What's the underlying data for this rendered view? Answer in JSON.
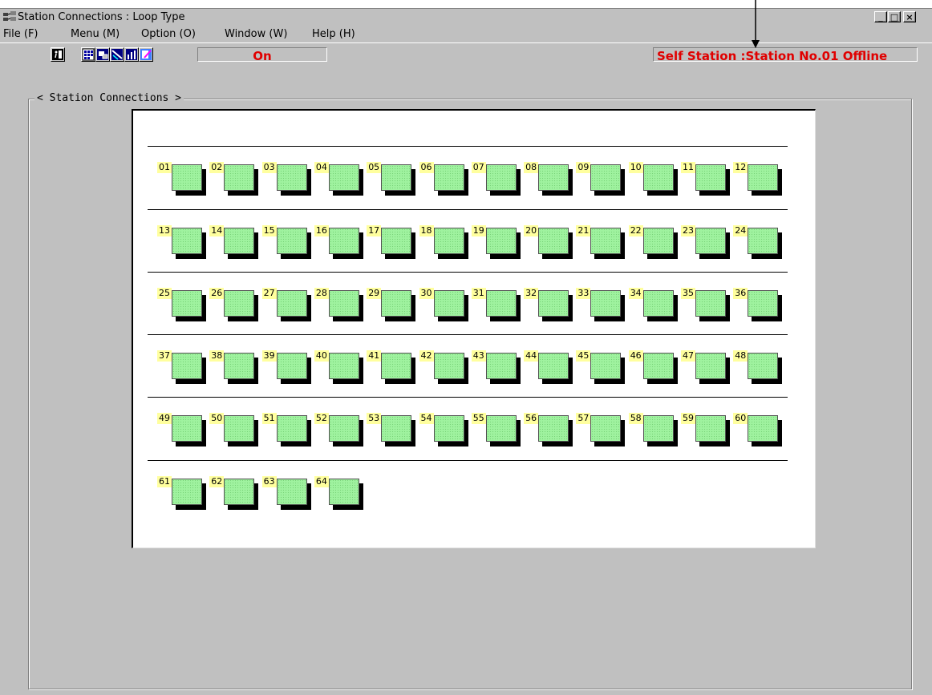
{
  "window": {
    "title": "Station Connections : Loop Type",
    "controls": [
      "_",
      "□",
      "×"
    ]
  },
  "menu": [
    {
      "label": "File (F)"
    },
    {
      "label": "Menu (M)"
    },
    {
      "label": "Option (O)"
    },
    {
      "label": "Window (W)"
    },
    {
      "label": "Help (H)"
    }
  ],
  "toolbar": {
    "buttons": [
      {
        "name": "exit-icon"
      },
      {
        "name": "grid-view-icon"
      },
      {
        "name": "monitor-icon"
      },
      {
        "name": "network-icon"
      },
      {
        "name": "chart-icon"
      },
      {
        "name": "edit-icon"
      }
    ],
    "mode_text": "On",
    "status_text": "Self Station :Station No.01  Offline"
  },
  "group": {
    "title": "< Station Connections >"
  },
  "stations": [
    "01",
    "02",
    "03",
    "04",
    "05",
    "06",
    "07",
    "08",
    "09",
    "10",
    "11",
    "12",
    "13",
    "14",
    "15",
    "16",
    "17",
    "18",
    "19",
    "20",
    "21",
    "22",
    "23",
    "24",
    "25",
    "26",
    "27",
    "28",
    "29",
    "30",
    "31",
    "32",
    "33",
    "34",
    "35",
    "36",
    "37",
    "38",
    "39",
    "40",
    "41",
    "42",
    "43",
    "44",
    "45",
    "46",
    "47",
    "48",
    "49",
    "50",
    "51",
    "52",
    "53",
    "54",
    "55",
    "56",
    "57",
    "58",
    "59",
    "60",
    "61",
    "62",
    "63",
    "64"
  ],
  "colors": {
    "station_fill": "#9ff29f",
    "label_bg": "#ffff9e",
    "status_text": "#e00000",
    "window_bg": "#c0c0c0"
  }
}
